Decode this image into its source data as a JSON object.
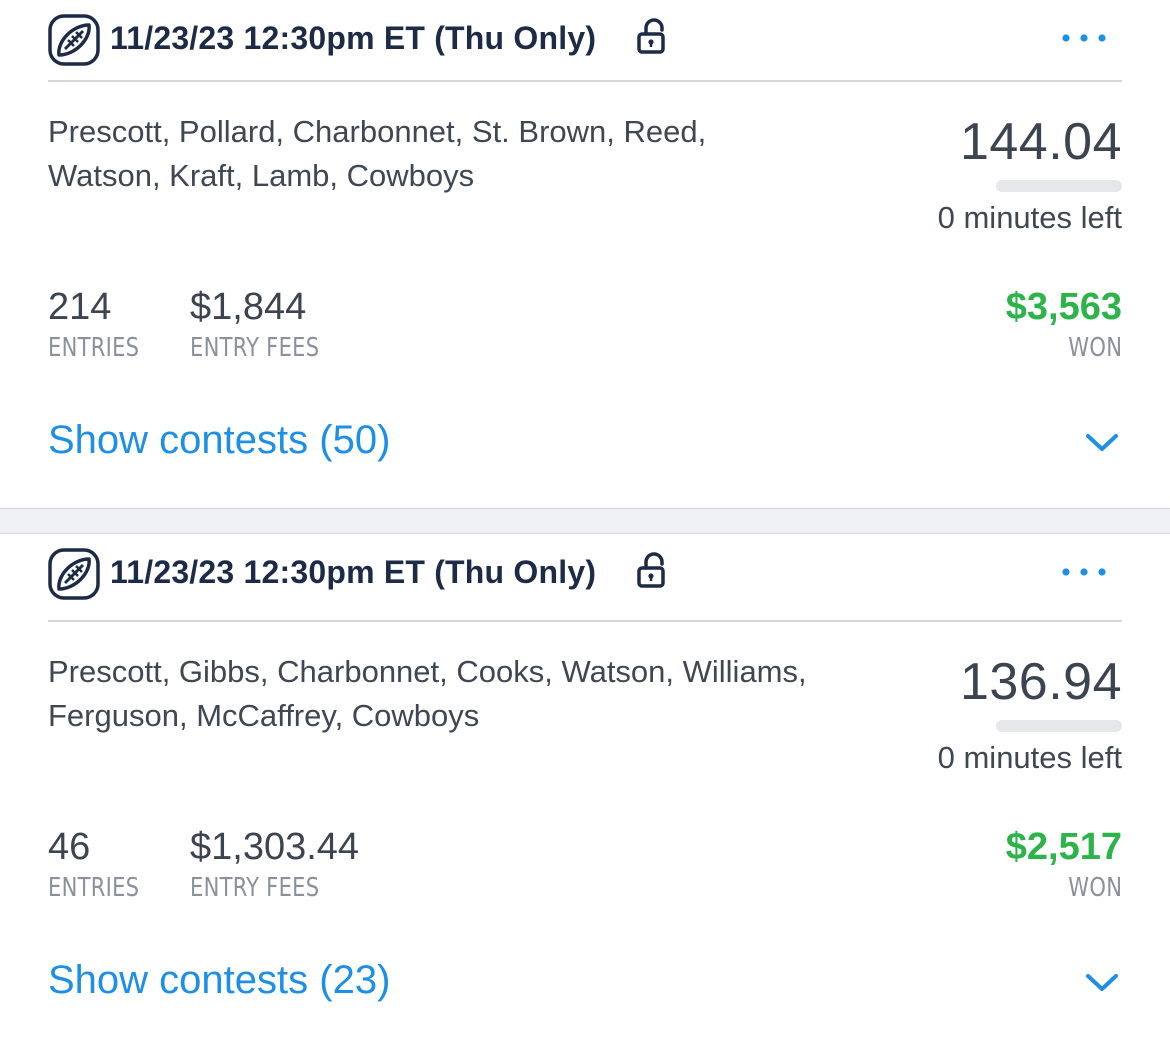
{
  "colors": {
    "accent_blue": "#1d8fe6",
    "won_green": "#2cb34a",
    "title_navy": "#1e2b46",
    "body_text": "#3f4753",
    "muted_label": "#8a919c"
  },
  "icons": {
    "sport": "football-icon",
    "lock": "unlocked-padlock-icon",
    "more": "more-dots-icon",
    "expand": "chevron-down-icon"
  },
  "cards": [
    {
      "slate": "11/23/23 12:30pm ET (Thu Only)",
      "lineup": "Prescott, Pollard, Charbonnet, St. Brown, Reed, Watson, Kraft, Lamb, Cowboys",
      "score": "144.04",
      "progress": 0,
      "time_left": "0 minutes left",
      "entries_value": "214",
      "entries_label": "ENTRIES",
      "fees_value": "$1,844",
      "fees_label": "ENTRY FEES",
      "won_value": "$3,563",
      "won_label": "WON",
      "show_contests": "Show contests (50)"
    },
    {
      "slate": "11/23/23 12:30pm ET (Thu Only)",
      "lineup": "Prescott, Gibbs, Charbonnet, Cooks, Watson, Williams, Ferguson, McCaffrey, Cowboys",
      "score": "136.94",
      "progress": 0,
      "time_left": "0 minutes left",
      "entries_value": "46",
      "entries_label": "ENTRIES",
      "fees_value": "$1,303.44",
      "fees_label": "ENTRY FEES",
      "won_value": "$2,517",
      "won_label": "WON",
      "show_contests": "Show contests (23)"
    }
  ]
}
